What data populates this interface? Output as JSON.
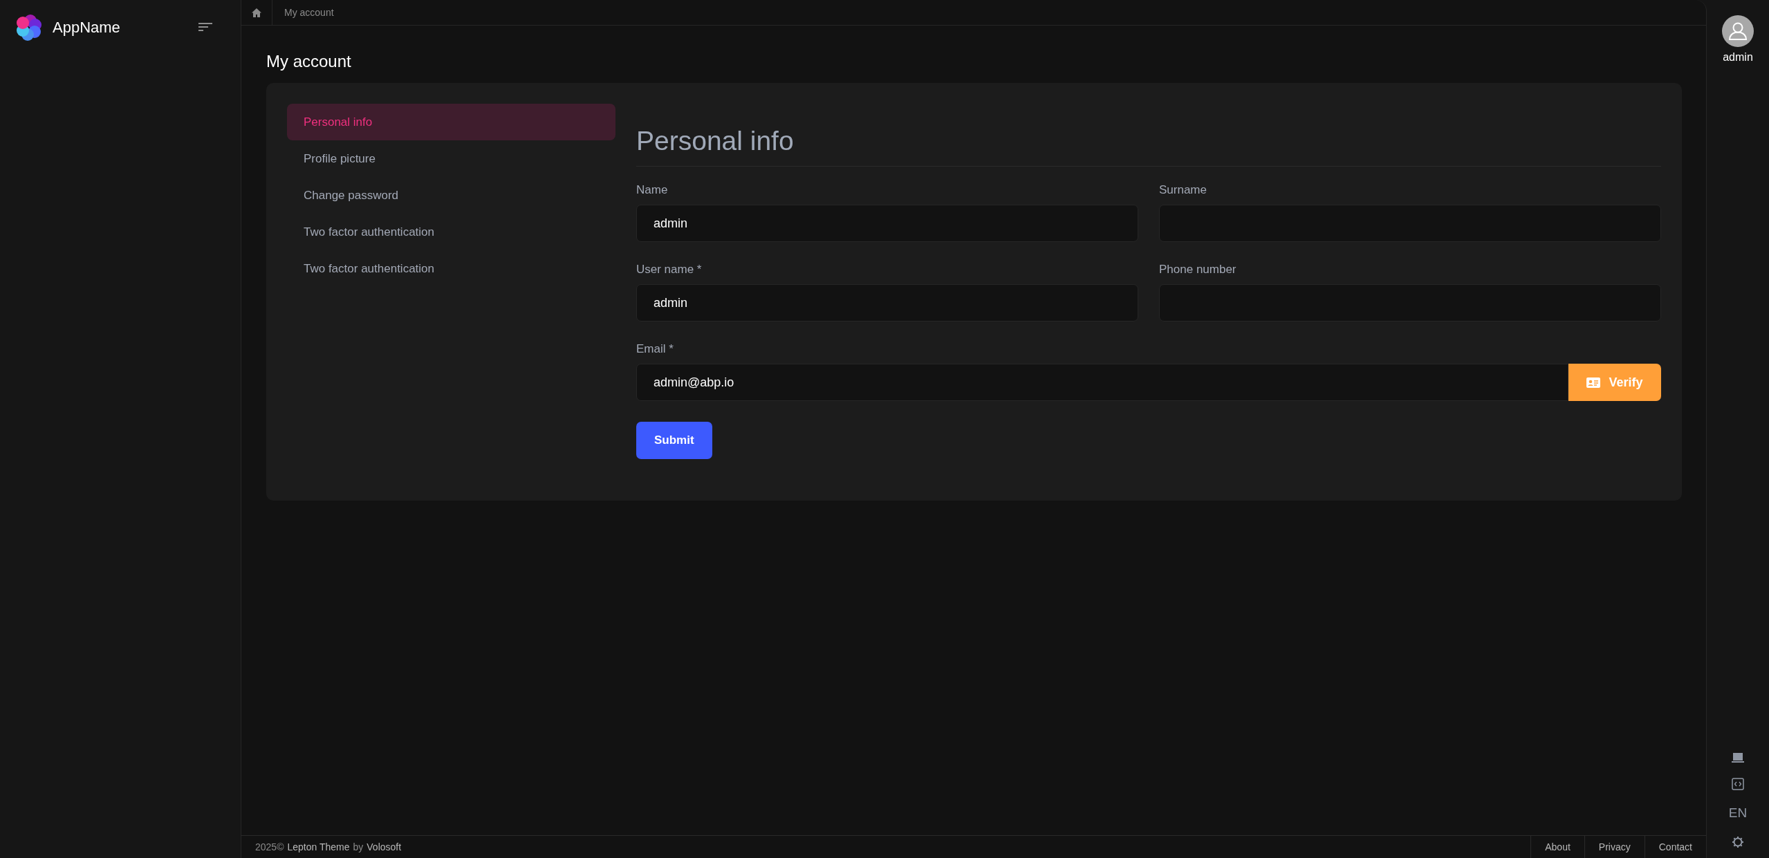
{
  "sidebar": {
    "app_name": "AppName"
  },
  "breadcrumb": {
    "items": [
      "My account"
    ]
  },
  "page_title": "My account",
  "account_nav": [
    {
      "label": "Personal info",
      "selected": true
    },
    {
      "label": "Profile picture",
      "selected": false
    },
    {
      "label": "Change password",
      "selected": false
    },
    {
      "label": "Two factor authentication",
      "selected": false
    },
    {
      "label": "Two factor authentication",
      "selected": false
    }
  ],
  "form": {
    "heading": "Personal info",
    "fields": [
      {
        "label": "Name",
        "value": "admin"
      },
      {
        "label": "Surname"
      },
      {
        "label": "User name *",
        "value": "admin"
      },
      {
        "label": "Phone number"
      }
    ],
    "email": {
      "label": "Email *",
      "value": "admin@abp.io",
      "button": "Verify"
    },
    "submit": "Submit"
  },
  "user": {
    "name": "admin"
  },
  "rail": {
    "language": "EN"
  },
  "footer": {
    "year": "2025©",
    "theme_link": "Lepton Theme",
    "by": "by",
    "company_link": "Volosoft",
    "links": [
      "About",
      "Privacy",
      "Contact"
    ]
  }
}
